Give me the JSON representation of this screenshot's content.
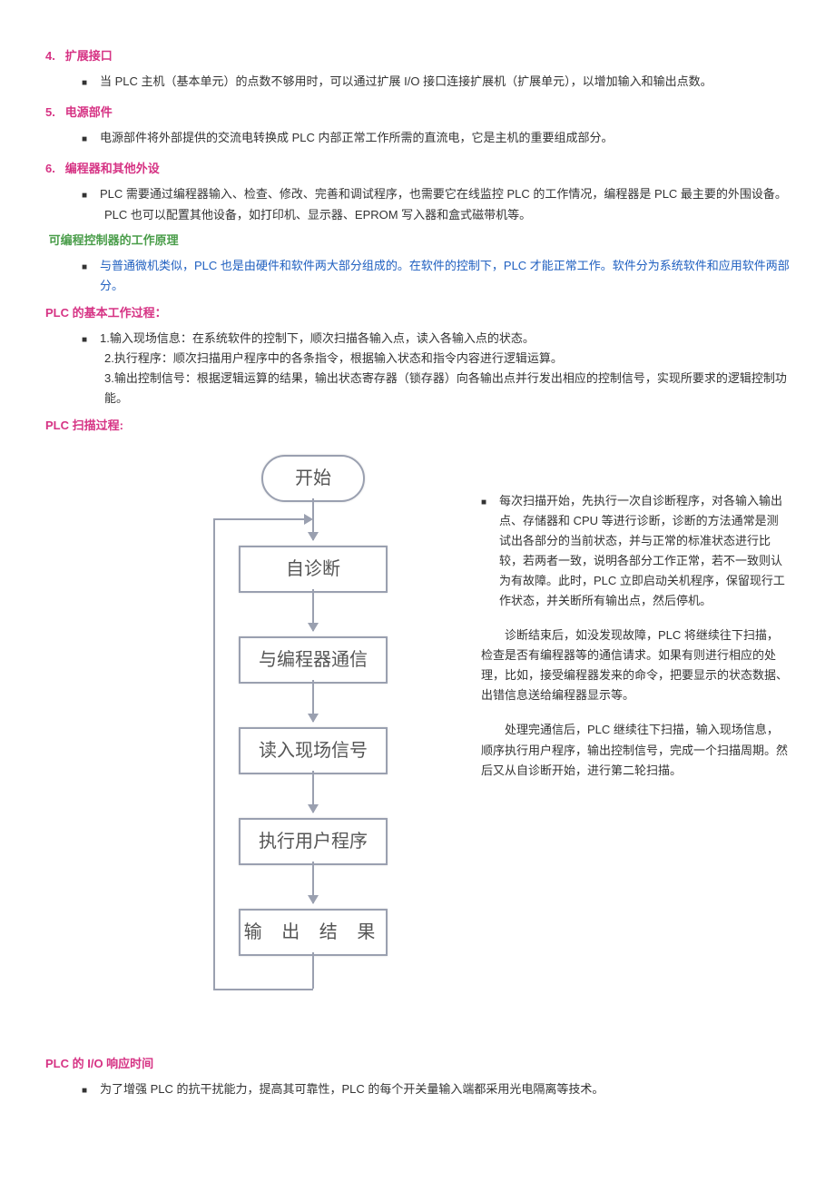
{
  "sec4": {
    "num": "4.",
    "title": "扩展接口",
    "items": [
      "当 PLC 主机（基本单元）的点数不够用时，可以通过扩展 I/O 接口连接扩展机（扩展单元），以增加输入和输出点数。"
    ]
  },
  "sec5": {
    "num": "5.",
    "title": "电源部件",
    "items": [
      "电源部件将外部提供的交流电转换成 PLC 内部正常工作所需的直流电，它是主机的重要组成部分。"
    ]
  },
  "sec6": {
    "num": "6.",
    "title": "编程器和其他外设",
    "items": [
      "PLC 需要通过编程器输入、检查、修改、完善和调试程序，也需要它在线监控 PLC 的工作情况，编程器是 PLC 最主要的外围设备。",
      "PLC 也可以配置其他设备，如打印机、显示器、EPROM 写入器和盒式磁带机等。"
    ]
  },
  "principle": {
    "title": "可编程控制器的工作原理",
    "item": "与普通微机类似，PLC 也是由硬件和软件两大部分组成的。在软件的控制下，PLC 才能正常工作。软件分为系统软件和应用软件两部分。"
  },
  "basic": {
    "title": "PLC 的基本工作过程：",
    "step1": "1.输入现场信息：在系统软件的控制下，顺次扫描各输入点，读入各输入点的状态。",
    "step2": "2.执行程序：顺次扫描用户程序中的各条指令，根据输入状态和指令内容进行逻辑运算。",
    "step3": "3.输出控制信号：根据逻辑运算的结果，输出状态寄存器（锁存器）向各输出点并行发出相应的控制信号，实现所要求的逻辑控制功能。"
  },
  "scan": {
    "title": "PLC 扫描过程:"
  },
  "flow": {
    "start": "开始",
    "diag": "自诊断",
    "comm": "与编程器通信",
    "read": "读入现场信号",
    "exec": "执行用户程序",
    "out": "输 出 结 果"
  },
  "desc": {
    "p1": "每次扫描开始，先执行一次自诊断程序，对各输入输出点、存储器和 CPU 等进行诊断，诊断的方法通常是测试出各部分的当前状态，并与正常的标准状态进行比较，若两者一致，说明各部分工作正常，若不一致则认为有故障。此时，PLC 立即启动关机程序，保留现行工作状态，并关断所有输出点，然后停机。",
    "p2": "诊断结束后，如没发现故障，PLC 将继续往下扫描，检查是否有编程器等的通信请求。如果有则进行相应的处理，比如，接受编程器发来的命令，把要显示的状态数据、出错信息送给编程器显示等。",
    "p3": "处理完通信后，PLC 继续往下扫描，输入现场信息，顺序执行用户程序，输出控制信号，完成一个扫描周期。然后又从自诊断开始，进行第二轮扫描。"
  },
  "io": {
    "title": "PLC 的 I/O 响应时间",
    "item": "为了增强 PLC 的抗干扰能力，提高其可靠性，PLC 的每个开关量输入端都采用光电隔离等技术。"
  }
}
